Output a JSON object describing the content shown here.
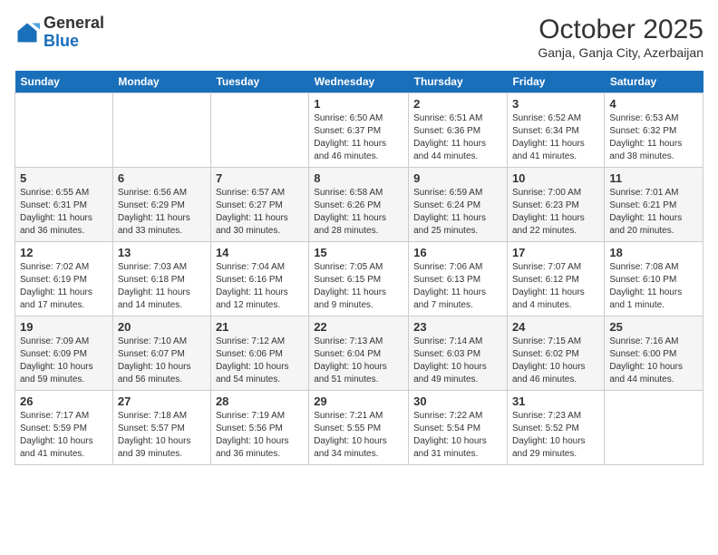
{
  "header": {
    "logo_general": "General",
    "logo_blue": "Blue",
    "month_title": "October 2025",
    "subtitle": "Ganja, Ganja City, Azerbaijan"
  },
  "days_of_week": [
    "Sunday",
    "Monday",
    "Tuesday",
    "Wednesday",
    "Thursday",
    "Friday",
    "Saturday"
  ],
  "weeks": [
    [
      {
        "day": "",
        "info": ""
      },
      {
        "day": "",
        "info": ""
      },
      {
        "day": "",
        "info": ""
      },
      {
        "day": "1",
        "info": "Sunrise: 6:50 AM\nSunset: 6:37 PM\nDaylight: 11 hours and 46 minutes."
      },
      {
        "day": "2",
        "info": "Sunrise: 6:51 AM\nSunset: 6:36 PM\nDaylight: 11 hours and 44 minutes."
      },
      {
        "day": "3",
        "info": "Sunrise: 6:52 AM\nSunset: 6:34 PM\nDaylight: 11 hours and 41 minutes."
      },
      {
        "day": "4",
        "info": "Sunrise: 6:53 AM\nSunset: 6:32 PM\nDaylight: 11 hours and 38 minutes."
      }
    ],
    [
      {
        "day": "5",
        "info": "Sunrise: 6:55 AM\nSunset: 6:31 PM\nDaylight: 11 hours and 36 minutes."
      },
      {
        "day": "6",
        "info": "Sunrise: 6:56 AM\nSunset: 6:29 PM\nDaylight: 11 hours and 33 minutes."
      },
      {
        "day": "7",
        "info": "Sunrise: 6:57 AM\nSunset: 6:27 PM\nDaylight: 11 hours and 30 minutes."
      },
      {
        "day": "8",
        "info": "Sunrise: 6:58 AM\nSunset: 6:26 PM\nDaylight: 11 hours and 28 minutes."
      },
      {
        "day": "9",
        "info": "Sunrise: 6:59 AM\nSunset: 6:24 PM\nDaylight: 11 hours and 25 minutes."
      },
      {
        "day": "10",
        "info": "Sunrise: 7:00 AM\nSunset: 6:23 PM\nDaylight: 11 hours and 22 minutes."
      },
      {
        "day": "11",
        "info": "Sunrise: 7:01 AM\nSunset: 6:21 PM\nDaylight: 11 hours and 20 minutes."
      }
    ],
    [
      {
        "day": "12",
        "info": "Sunrise: 7:02 AM\nSunset: 6:19 PM\nDaylight: 11 hours and 17 minutes."
      },
      {
        "day": "13",
        "info": "Sunrise: 7:03 AM\nSunset: 6:18 PM\nDaylight: 11 hours and 14 minutes."
      },
      {
        "day": "14",
        "info": "Sunrise: 7:04 AM\nSunset: 6:16 PM\nDaylight: 11 hours and 12 minutes."
      },
      {
        "day": "15",
        "info": "Sunrise: 7:05 AM\nSunset: 6:15 PM\nDaylight: 11 hours and 9 minutes."
      },
      {
        "day": "16",
        "info": "Sunrise: 7:06 AM\nSunset: 6:13 PM\nDaylight: 11 hours and 7 minutes."
      },
      {
        "day": "17",
        "info": "Sunrise: 7:07 AM\nSunset: 6:12 PM\nDaylight: 11 hours and 4 minutes."
      },
      {
        "day": "18",
        "info": "Sunrise: 7:08 AM\nSunset: 6:10 PM\nDaylight: 11 hours and 1 minute."
      }
    ],
    [
      {
        "day": "19",
        "info": "Sunrise: 7:09 AM\nSunset: 6:09 PM\nDaylight: 10 hours and 59 minutes."
      },
      {
        "day": "20",
        "info": "Sunrise: 7:10 AM\nSunset: 6:07 PM\nDaylight: 10 hours and 56 minutes."
      },
      {
        "day": "21",
        "info": "Sunrise: 7:12 AM\nSunset: 6:06 PM\nDaylight: 10 hours and 54 minutes."
      },
      {
        "day": "22",
        "info": "Sunrise: 7:13 AM\nSunset: 6:04 PM\nDaylight: 10 hours and 51 minutes."
      },
      {
        "day": "23",
        "info": "Sunrise: 7:14 AM\nSunset: 6:03 PM\nDaylight: 10 hours and 49 minutes."
      },
      {
        "day": "24",
        "info": "Sunrise: 7:15 AM\nSunset: 6:02 PM\nDaylight: 10 hours and 46 minutes."
      },
      {
        "day": "25",
        "info": "Sunrise: 7:16 AM\nSunset: 6:00 PM\nDaylight: 10 hours and 44 minutes."
      }
    ],
    [
      {
        "day": "26",
        "info": "Sunrise: 7:17 AM\nSunset: 5:59 PM\nDaylight: 10 hours and 41 minutes."
      },
      {
        "day": "27",
        "info": "Sunrise: 7:18 AM\nSunset: 5:57 PM\nDaylight: 10 hours and 39 minutes."
      },
      {
        "day": "28",
        "info": "Sunrise: 7:19 AM\nSunset: 5:56 PM\nDaylight: 10 hours and 36 minutes."
      },
      {
        "day": "29",
        "info": "Sunrise: 7:21 AM\nSunset: 5:55 PM\nDaylight: 10 hours and 34 minutes."
      },
      {
        "day": "30",
        "info": "Sunrise: 7:22 AM\nSunset: 5:54 PM\nDaylight: 10 hours and 31 minutes."
      },
      {
        "day": "31",
        "info": "Sunrise: 7:23 AM\nSunset: 5:52 PM\nDaylight: 10 hours and 29 minutes."
      },
      {
        "day": "",
        "info": ""
      }
    ]
  ]
}
